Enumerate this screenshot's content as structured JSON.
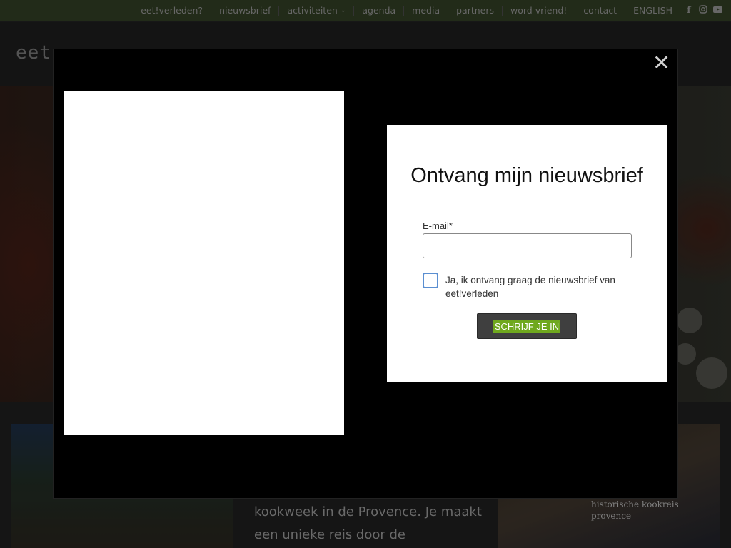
{
  "nav": {
    "items": [
      {
        "label": "eet!verleden?"
      },
      {
        "label": "nieuwsbrief"
      },
      {
        "label": "activiteiten"
      },
      {
        "label": "agenda"
      },
      {
        "label": "media"
      },
      {
        "label": "partners"
      },
      {
        "label": "word vriend!"
      },
      {
        "label": "contact"
      },
      {
        "label": "ENGLISH"
      }
    ],
    "social": [
      "facebook-icon",
      "instagram-icon",
      "youtube-icon"
    ]
  },
  "header": {
    "logo_text": "eet"
  },
  "content": {
    "body_text": "kookweek in de Provence. Je maakt een unieke reis door de",
    "card_right_text": "historische kookreis provence"
  },
  "modal": {
    "close_symbol": "✕",
    "title": "Ontvang mijn nieuwsbrief",
    "email_label": "E-mail*",
    "email_value": "",
    "checkbox_label": "Ja, ik ontvang graag de nieuwsbrief van eet!verleden",
    "submit_label": "SCHRIJF JE IN"
  },
  "colors": {
    "topbar_bg": "#2e3a22",
    "accent_green": "#6fa81e",
    "checkbox_border": "#5b8fd1"
  }
}
